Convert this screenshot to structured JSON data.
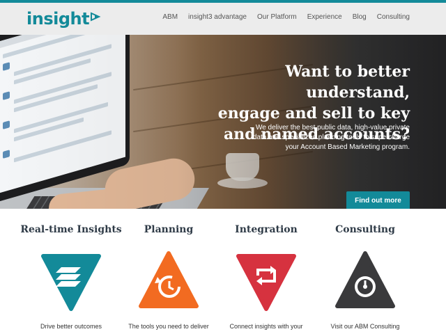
{
  "brand": {
    "name": "insight",
    "accent": "#138a99"
  },
  "nav": [
    {
      "label": "ABM"
    },
    {
      "label": "insight3 advantage"
    },
    {
      "label": "Our Platform"
    },
    {
      "label": "Experience"
    },
    {
      "label": "Blog"
    },
    {
      "label": "Consulting"
    }
  ],
  "hero": {
    "title_line1": "Want to better understand,",
    "title_line2": "engage and sell to key",
    "title_line3": "and named accounts?",
    "sub_line1": "We deliver the best public data, high-value private",
    "sub_line2": "data and specialized planning tools to supercharge",
    "sub_line3": "your Account Based Marketing program.",
    "cta_label": "Find out more"
  },
  "features": [
    {
      "title": "Real-time Insights",
      "icon": "stack-layers-icon",
      "color": "#138a99",
      "desc": "Drive better outcomes"
    },
    {
      "title": "Planning",
      "icon": "refresh-clock-icon",
      "color": "#f26b21",
      "desc": "The tools you need to deliver"
    },
    {
      "title": "Integration",
      "icon": "sync-arrows-icon",
      "color": "#d6323f",
      "desc": "Connect insights with your"
    },
    {
      "title": "Consulting",
      "icon": "gauge-icon",
      "color": "#3a3a3c",
      "desc": "Visit our ABM Consulting"
    }
  ]
}
